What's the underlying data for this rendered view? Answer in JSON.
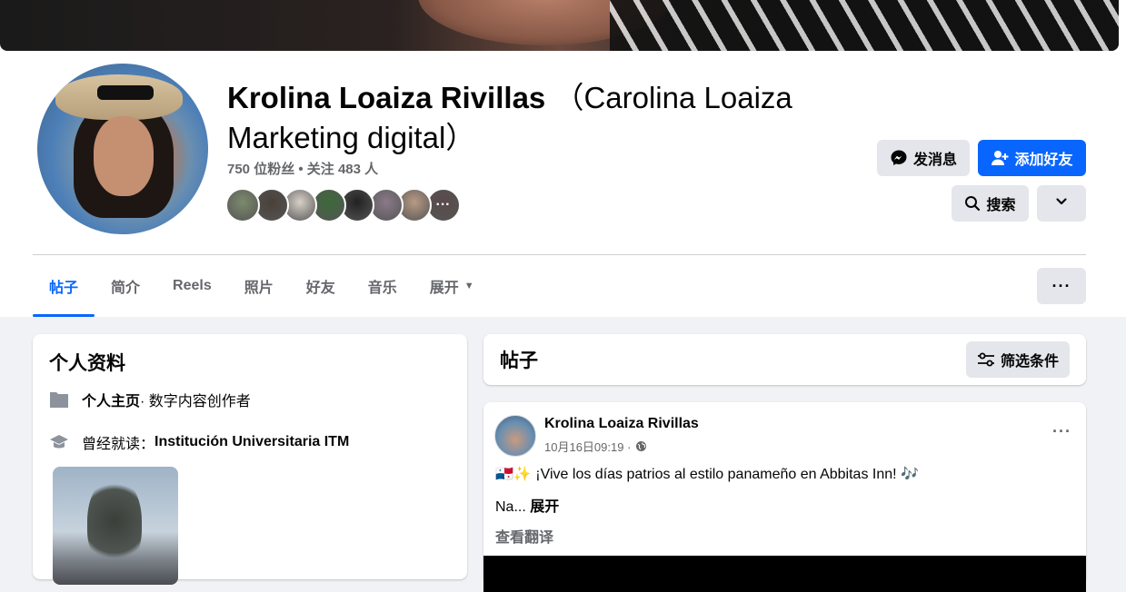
{
  "profile": {
    "name": "Krolina Loaiza Rivillas",
    "alt_name": "（Carolina Loaiza Marketing digital）",
    "stats": "750 位粉丝 • 关注 483 人",
    "friend_more": "···",
    "friend_colors": [
      "#7c8a6c",
      "#4a4038",
      "#d8d0c8",
      "#3c6a3a",
      "#222222",
      "#8a7a88",
      "#b89a84",
      "#5a4a4a"
    ]
  },
  "actions": {
    "message_label": "发消息",
    "add_friend_label": "添加好友",
    "search_label": "搜索",
    "more_icon": "chevron-down-icon"
  },
  "tabs": {
    "items": [
      {
        "label": "帖子"
      },
      {
        "label": "简介"
      },
      {
        "label": "Reels"
      },
      {
        "label": "照片"
      },
      {
        "label": "好友"
      },
      {
        "label": "音乐"
      },
      {
        "label": "展开"
      }
    ],
    "more_dots": "···"
  },
  "intro": {
    "title": "个人资料",
    "page_label": "个人主页",
    "page_category": " · 数字内容创作者",
    "education_prefix": "曾经就读：",
    "education_school": "Institución Universitaria ITM"
  },
  "posts": {
    "title": "帖子",
    "filter_label": "筛选条件"
  },
  "post": {
    "author": "Krolina Loaiza Rivillas",
    "time": "10月16日09:19 · ",
    "text": "🇵🇦✨ ¡Vive los días patrios al estilo panameño en Abbitas Inn! 🎶",
    "text2": "Na... ",
    "see_more": "展开",
    "see_translation": "查看翻译",
    "dots": "···"
  },
  "colors": {
    "accent": "#0866ff",
    "button_gray": "#e4e6eb",
    "page_bg": "#f0f2f5",
    "secondary_text": "#65676b"
  }
}
